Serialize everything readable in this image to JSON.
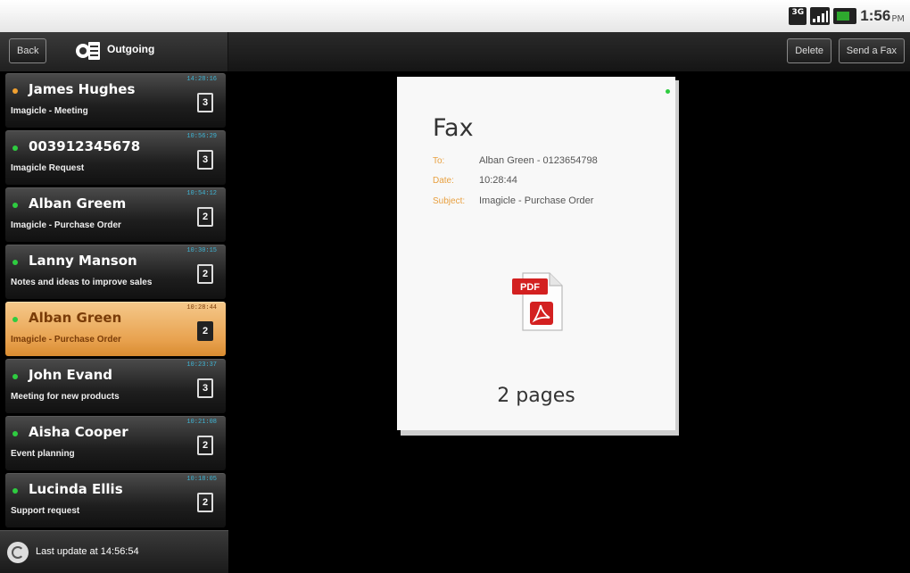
{
  "status_bar": {
    "network": "3G",
    "time": "1:56",
    "ampm": "PM"
  },
  "action_bar": {
    "back_label": "Back",
    "title": "Outgoing",
    "delete_label": "Delete",
    "send_label": "Send a Fax"
  },
  "fax_list": [
    {
      "name": "James Hughes",
      "subject": "Imagicle - Meeting",
      "time": "14:28:16",
      "pages": "3",
      "dot": "orange"
    },
    {
      "name": "003912345678",
      "subject": "Imagicle Request",
      "time": "10:56:29",
      "pages": "3",
      "dot": "green"
    },
    {
      "name": "Alban Greem",
      "subject": "Imagicle - Purchase Order",
      "time": "10:54:12",
      "pages": "2",
      "dot": "green"
    },
    {
      "name": "Lanny Manson",
      "subject": "Notes and ideas to improve sales",
      "time": "10:30:15",
      "pages": "2",
      "dot": "green"
    },
    {
      "name": "Alban Green",
      "subject": "Imagicle - Purchase Order",
      "time": "10:28:44",
      "pages": "2",
      "dot": "green",
      "selected": true
    },
    {
      "name": "John Evand",
      "subject": "Meeting for new products",
      "time": "10:23:37",
      "pages": "3",
      "dot": "green"
    },
    {
      "name": "Aisha Cooper",
      "subject": "Event planning",
      "time": "10:21:08",
      "pages": "2",
      "dot": "green"
    },
    {
      "name": "Lucinda Ellis",
      "subject": "Support request",
      "time": "10:18:05",
      "pages": "2",
      "dot": "green"
    }
  ],
  "footer": {
    "last_update": "Last update at 14:56:54"
  },
  "preview": {
    "title": "Fax",
    "to_label": "To:",
    "to_value": "Alban Green - 0123654798",
    "date_label": "Date:",
    "date_value": "10:28:44",
    "subject_label": "Subject:",
    "subject_value": "Imagicle - Purchase Order",
    "pdf_label": "PDF",
    "pages_text": "2 pages"
  },
  "colors": {
    "selected_row": "#e8a24f",
    "accent_time": "#3fb6d6",
    "status_green": "#2ecc40",
    "label_orange": "#e8a040"
  }
}
